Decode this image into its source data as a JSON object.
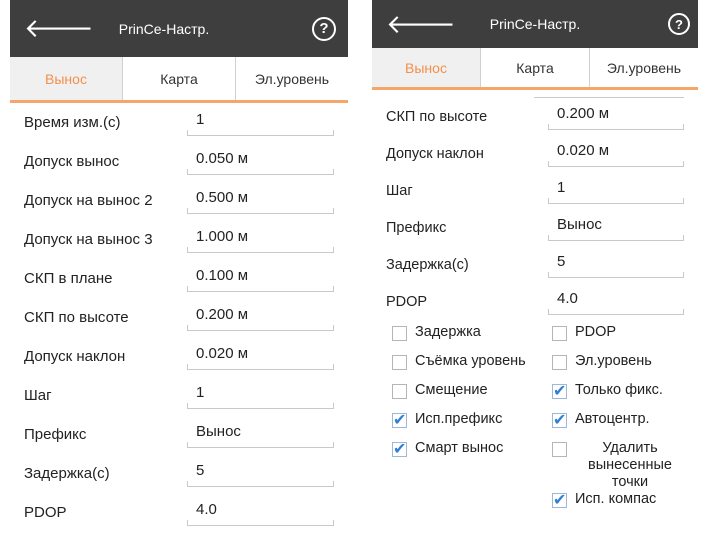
{
  "appbar": {
    "title": "PrinCe-Настр.",
    "back_glyph": "🡐",
    "help_glyph": "?"
  },
  "tabs": [
    "Вынос",
    "Карта",
    "Эл.уровень"
  ],
  "left_rows": [
    {
      "label": "Время изм.(с)",
      "value": "1"
    },
    {
      "label": "Допуск вынос",
      "value": "0.050 м"
    },
    {
      "label": "Допуск на вынос 2",
      "value": "0.500 м"
    },
    {
      "label": "Допуск на вынос 3",
      "value": "1.000 м"
    },
    {
      "label": "СКП в плане",
      "value": "0.100 м"
    },
    {
      "label": "СКП по высоте",
      "value": "0.200 м"
    },
    {
      "label": "Допуск наклон",
      "value": "0.020 м"
    },
    {
      "label": "Шаг",
      "value": "1"
    },
    {
      "label": "Префикс",
      "value": "Вынос"
    },
    {
      "label": "Задержка(с)",
      "value": "5"
    },
    {
      "label": "PDOP",
      "value": "4.0"
    }
  ],
  "right_rows": [
    {
      "label": "СКП по высоте",
      "value": "0.200 м"
    },
    {
      "label": "Допуск наклон",
      "value": "0.020 м"
    },
    {
      "label": "Шаг",
      "value": "1"
    },
    {
      "label": "Префикс",
      "value": "Вынос"
    },
    {
      "label": "Задержка(с)",
      "value": "5"
    },
    {
      "label": "PDOP",
      "value": "4.0"
    }
  ],
  "checkboxes": [
    [
      {
        "label": "Задержка",
        "checked": false
      },
      {
        "label": "PDOP",
        "checked": false
      }
    ],
    [
      {
        "label": "Съёмка уровень",
        "checked": false
      },
      {
        "label": "Эл.уровень",
        "checked": false
      }
    ],
    [
      {
        "label": "Смещение",
        "checked": false
      },
      {
        "label": "Только фикс.",
        "checked": true
      }
    ],
    [
      {
        "label": "Исп.префикс",
        "checked": true
      },
      {
        "label": "Автоцентр.",
        "checked": true
      }
    ],
    [
      {
        "label": "Смарт вынос",
        "checked": true
      },
      {
        "label": "Удалить вынесенные точки",
        "checked": false
      }
    ],
    [
      null,
      {
        "label": "Исп. компас",
        "checked": true
      }
    ]
  ]
}
